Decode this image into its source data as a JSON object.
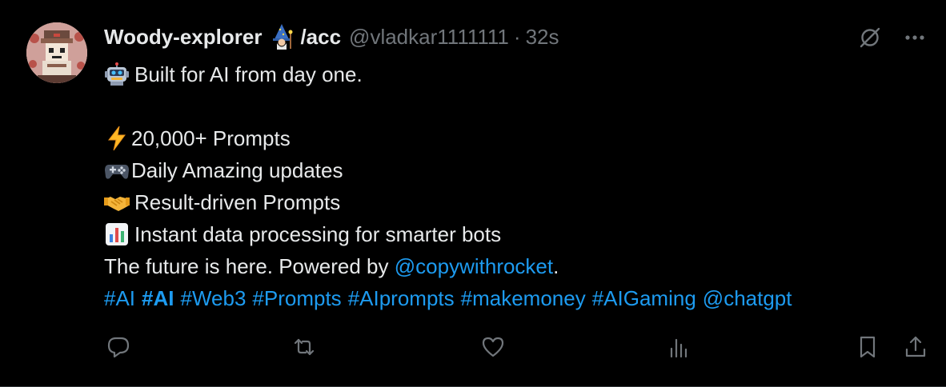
{
  "author": {
    "display_name": "Woody-explorer",
    "name_suffix": "/acc",
    "handle": "@vladkar1111111",
    "separator": "·",
    "timestamp": "32s"
  },
  "icons": {
    "avatar": "pixel-art-avatar",
    "wizard": "wizard-emoji",
    "grok": "grok-icon",
    "more": "more-icon",
    "robot": "robot-emoji",
    "lightning": "lightning-emoji",
    "gamepad": "gamepad-emoji",
    "handshake": "handshake-emoji",
    "chart": "bar-chart-emoji"
  },
  "tweet": {
    "line1": "Built for AI from day one.",
    "line2": "20,000+ Prompts",
    "line3": "Daily Amazing updates",
    "line4": "Result-driven Prompts",
    "line5": "Instant data processing for smarter bots",
    "line6_prefix": "The future is here. Powered by",
    "line6_mention": "@copywithrocket",
    "line6_suffix": " .",
    "hashtags": [
      "#AI",
      "#AI",
      "#Web3",
      "#Prompts",
      "#AIprompts",
      "#makemoney",
      "#AIGaming",
      "@chatgpt"
    ]
  },
  "actions": [
    "reply",
    "repost",
    "like",
    "views",
    "bookmark",
    "share"
  ],
  "colors": {
    "background": "#000000",
    "text": "#e7e9ea",
    "secondary": "#71767b",
    "link": "#1d9bf0"
  }
}
